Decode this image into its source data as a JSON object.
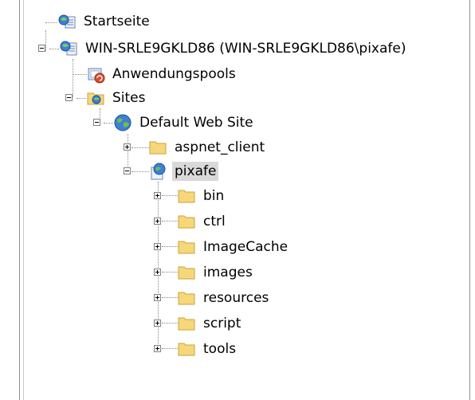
{
  "tree": {
    "startpage": "Startseite",
    "server": "WIN-SRLE9GKLD86 (WIN-SRLE9GKLD86\\pixafe)",
    "app_pools": "Anwendungspools",
    "sites": "Sites",
    "default_site": "Default Web Site",
    "aspnet_client": "aspnet_client",
    "pixafe": "pixafe",
    "folders": [
      "bin",
      "ctrl",
      "ImageCache",
      "images",
      "resources",
      "script",
      "tools"
    ]
  },
  "colors": {
    "folder": "#f6d77a",
    "folder_edge": "#c7a43b",
    "selection": "#d9d9d9"
  }
}
